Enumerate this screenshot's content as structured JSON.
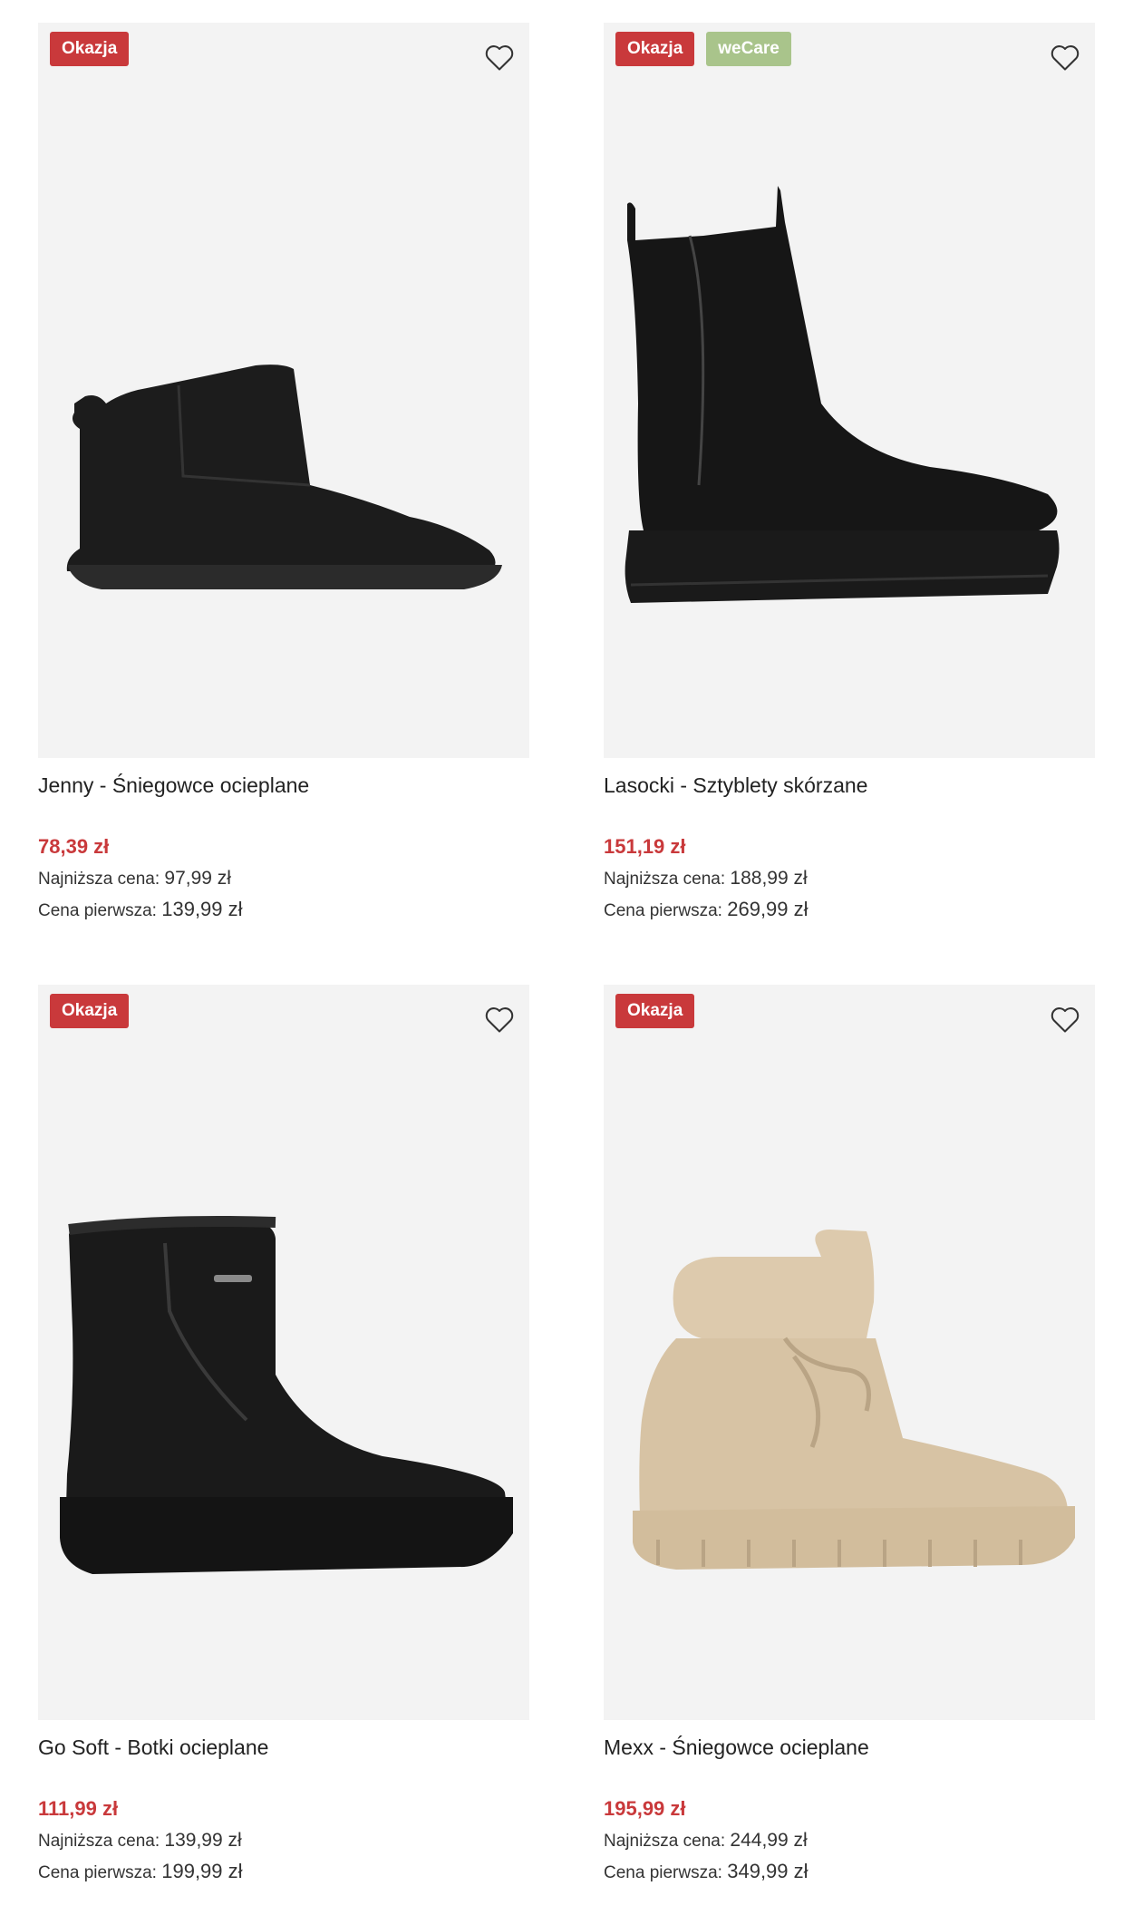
{
  "products": [
    {
      "badges": [
        "Okazja"
      ],
      "name": "Jenny - Śniegowce ocieplane",
      "price": "78,39 zł",
      "lowest_label": "Najniższa cena:",
      "lowest_value": "97,99 zł",
      "first_label": "Cena pierwsza:",
      "first_value": "139,99 zł",
      "image": "black-suede-mini-snow-boot"
    },
    {
      "badges": [
        "Okazja",
        "weCare"
      ],
      "name": "Lasocki - Sztyblety skórzane",
      "price": "151,19 zł",
      "lowest_label": "Najniższa cena:",
      "lowest_value": "188,99 zł",
      "first_label": "Cena pierwsza:",
      "first_value": "269,99 zł",
      "image": "black-leather-chelsea-boot"
    },
    {
      "badges": [
        "Okazja"
      ],
      "name": "Go Soft - Botki ocieplane",
      "price": "111,99 zł",
      "lowest_label": "Najniższa cena:",
      "lowest_value": "139,99 zł",
      "first_label": "Cena pierwsza:",
      "first_value": "199,99 zł",
      "image": "black-suede-zip-ankle-boot"
    },
    {
      "badges": [
        "Okazja"
      ],
      "name": "Mexx - Śniegowce ocieplane",
      "price": "195,99 zł",
      "lowest_label": "Najniższa cena:",
      "lowest_value": "244,99 zł",
      "first_label": "Cena pierwsza:",
      "first_value": "349,99 zł",
      "image": "beige-puffer-lace-up-boot"
    }
  ],
  "colors": {
    "badge_sale": "#c9393b",
    "badge_wecare": "#a9c48b",
    "price": "#c9393b",
    "image_bg": "#f3f3f3"
  },
  "icons": {
    "favorite": "heart-outline-icon"
  }
}
